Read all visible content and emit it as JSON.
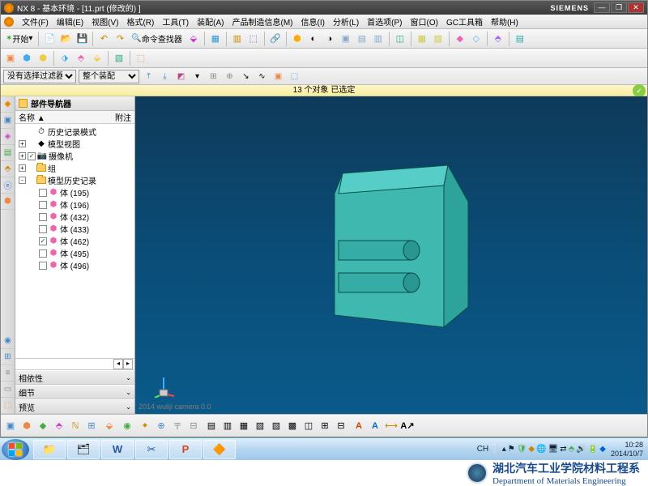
{
  "title": "NX 8 - 基本环境 - [11.prt (修改的) ]",
  "brand": "SIEMENS",
  "menu": [
    "文件(F)",
    "编辑(E)",
    "视图(V)",
    "格式(R)",
    "工具(T)",
    "装配(A)",
    "产品制造信息(M)",
    "信息(I)",
    "分析(L)",
    "首选项(P)",
    "窗口(O)",
    "GC工具箱",
    "帮助(H)"
  ],
  "start_label": "开始",
  "cmd_finder": "命令查找器",
  "filter": {
    "sel1": "没有选择过滤器",
    "sel2": "整个装配"
  },
  "status": "13 个对象 已选定",
  "nav": {
    "title": "部件导航器",
    "col_name": "名称 ▲",
    "col_ann": "附注",
    "items": [
      {
        "lvl": 0,
        "tg": "",
        "ck": "",
        "ic": "⏱",
        "label": "历史记录模式"
      },
      {
        "lvl": 0,
        "tg": "+",
        "ck": "",
        "ic": "◆",
        "label": "模型视图"
      },
      {
        "lvl": 0,
        "tg": "+",
        "ck": "on",
        "ic": "📷",
        "label": "摄像机"
      },
      {
        "lvl": 0,
        "tg": "+",
        "ck": "",
        "ic": "fld",
        "label": "组"
      },
      {
        "lvl": 0,
        "tg": "-",
        "ck": "",
        "ic": "fld",
        "label": "模型历史记录"
      },
      {
        "lvl": 1,
        "tg": "",
        "ck": "off",
        "ic": "b",
        "label": "体 (195)"
      },
      {
        "lvl": 1,
        "tg": "",
        "ck": "off",
        "ic": "b",
        "label": "体 (196)"
      },
      {
        "lvl": 1,
        "tg": "",
        "ck": "off",
        "ic": "b",
        "label": "体 (432)"
      },
      {
        "lvl": 1,
        "tg": "",
        "ck": "off",
        "ic": "b",
        "label": "体 (433)"
      },
      {
        "lvl": 1,
        "tg": "",
        "ck": "on",
        "ic": "b",
        "label": "体 (462)"
      },
      {
        "lvl": 1,
        "tg": "",
        "ck": "off",
        "ic": "b",
        "label": "体 (495)"
      },
      {
        "lvl": 1,
        "tg": "",
        "ck": "off",
        "ic": "b",
        "label": "体 (496)"
      }
    ],
    "acc": [
      "相依性",
      "细节",
      "预览"
    ]
  },
  "watermark": "2014 wuliji camera 0.0",
  "taskbar": {
    "lang": "CH",
    "time": "10:28",
    "date": "2014/10/7"
  },
  "footer": {
    "cn": "湖北汽车工业学院材料工程系",
    "en": "Department of Materials Engineering"
  }
}
